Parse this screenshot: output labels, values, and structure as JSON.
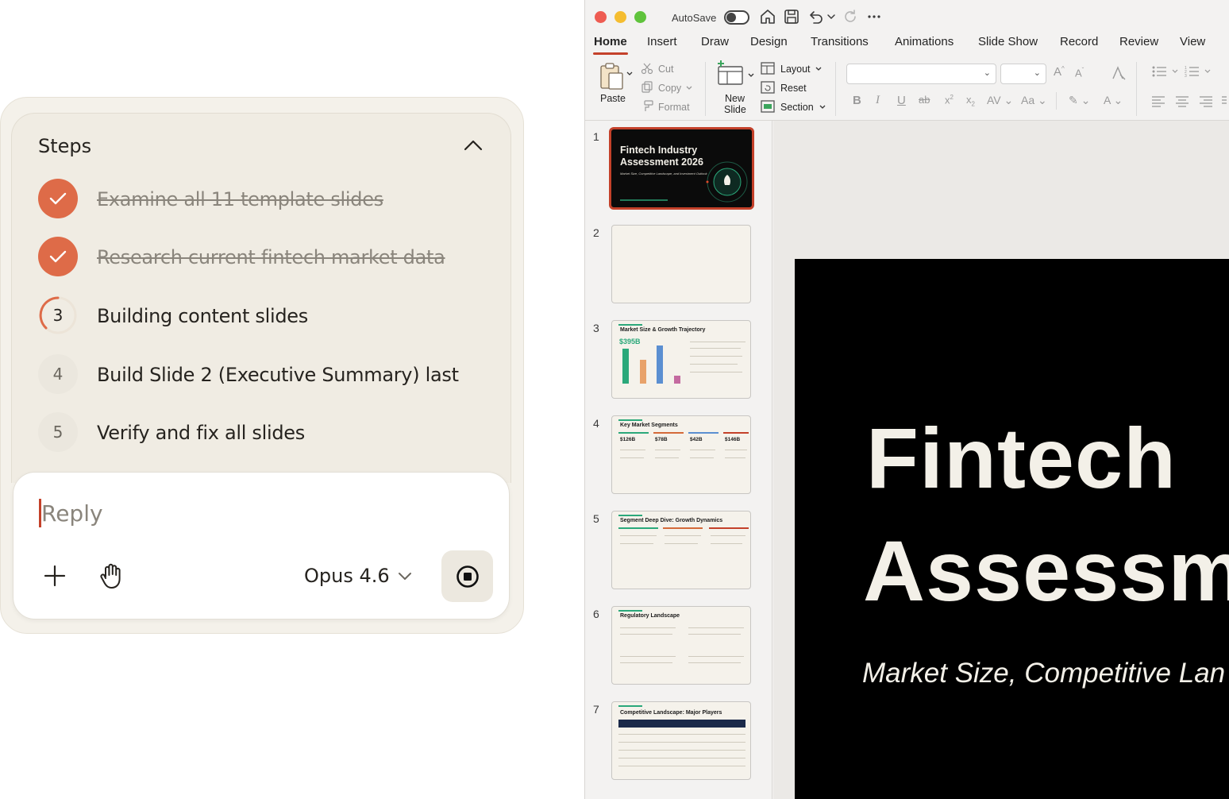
{
  "steps_panel": {
    "title": "Steps",
    "steps": [
      {
        "marker": "",
        "label": "Examine all 11 template slides",
        "status": "done"
      },
      {
        "marker": "",
        "label": "Research current fintech market data",
        "status": "done"
      },
      {
        "marker": "3",
        "label": "Building content slides",
        "status": "in-progress"
      },
      {
        "marker": "4",
        "label": "Build Slide 2 (Executive Summary) last",
        "status": "pending"
      },
      {
        "marker": "5",
        "label": "Verify and fix all slides",
        "status": "pending"
      }
    ]
  },
  "composer": {
    "placeholder": "Reply",
    "model": "Opus 4.6"
  },
  "colors": {
    "accent": "#de6b48",
    "ppt_accent": "#c4412a",
    "panel_bg": "#f4f1ea"
  },
  "ppt": {
    "autosave_label": "AutoSave",
    "tabs": [
      "Home",
      "Insert",
      "Draw",
      "Design",
      "Transitions",
      "Animations",
      "Slide Show",
      "Record",
      "Review",
      "View"
    ],
    "ribbon": {
      "paste": "Paste",
      "cut": "Cut",
      "copy": "Copy",
      "format": "Format",
      "new_slide_1": "New",
      "new_slide_2": "Slide",
      "layout": "Layout",
      "reset": "Reset",
      "section": "Section"
    },
    "thumbnails": [
      {
        "num": "1",
        "title": "Fintech Industry Assessment 2026",
        "subtitle": "Market Size, Competitive Landscape, and Investment Outlook"
      },
      {
        "num": "2",
        "title": ""
      },
      {
        "num": "3",
        "title": "Market Size & Growth Trajectory",
        "big_value": "$395B"
      },
      {
        "num": "4",
        "title": "Key Market Segments",
        "values": [
          "$126B",
          "$78B",
          "$42B",
          "$146B"
        ]
      },
      {
        "num": "5",
        "title": "Segment Deep Dive: Growth Dynamics"
      },
      {
        "num": "6",
        "title": "Regulatory Landscape"
      },
      {
        "num": "7",
        "title": "Competitive Landscape: Major Players"
      }
    ],
    "main_slide": {
      "title_line_1": "Fintech",
      "title_line_2": "Assessm",
      "subtitle": "Market Size, Competitive Lan"
    }
  }
}
